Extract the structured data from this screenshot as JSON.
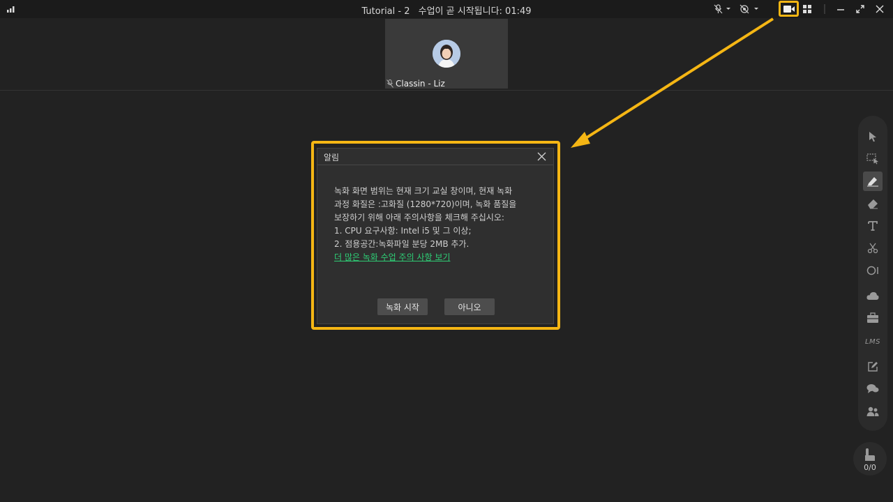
{
  "titlebar": {
    "title": "Tutorial - 2",
    "countdown": "수업이 곧 시작됩니다: 01:49",
    "icons": [
      "signal-icon",
      "mic-muted-icon",
      "camera-muted-icon",
      "video-record-icon",
      "grid-layout-icon",
      "minimize-icon",
      "fullscreen-icon",
      "close-icon"
    ]
  },
  "video": {
    "participant_name": "Classin - Liz"
  },
  "dialog": {
    "title": "알림",
    "lines": [
      "녹화 화면 범위는 현재 크기 교실 창이며, 현재 녹화",
      "과정 화질은 :고화질 (1280*720)이며, 녹화 품질을",
      "보장하기 위해 아래 주의사항을 체크해 주십시오:",
      "1. CPU 요구사항: Intel i5 및 그 이상;",
      "2. 점용공간:녹화파일 분당 2MB 추가."
    ],
    "link": "더 많은 녹화 수업 주의 사항 보기",
    "confirm_label": "녹화 시작",
    "cancel_label": "아니오"
  },
  "toolbar": {
    "lms_label": "LMS",
    "hand_count": "0/0",
    "tools": [
      "select-icon",
      "area-select-icon",
      "pen-icon",
      "eraser-icon",
      "text-icon",
      "scissors-icon",
      "shape-icon",
      "cloud-icon",
      "toolbox-icon",
      "lms-icon",
      "edit-icon",
      "chat-icon",
      "users-icon"
    ]
  },
  "colors": {
    "highlight": "#f5b614",
    "link": "#2ecf76",
    "background": "#222222"
  }
}
